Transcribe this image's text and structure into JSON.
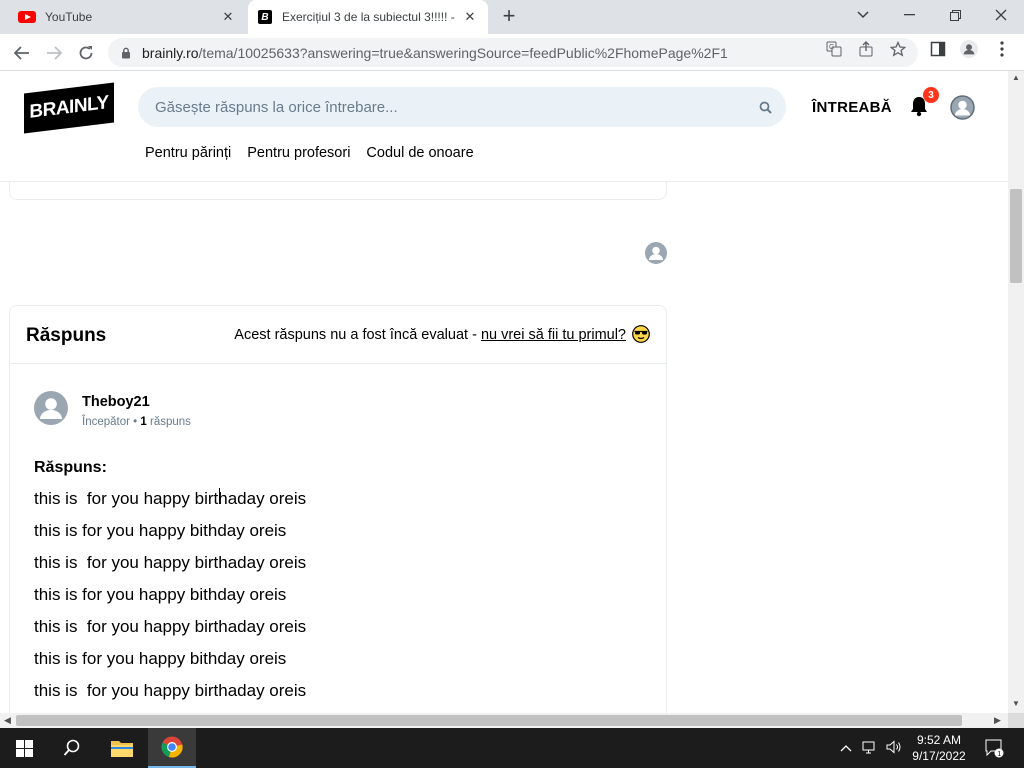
{
  "browser": {
    "tabs": [
      {
        "title": "YouTube",
        "close": "✕"
      },
      {
        "title": "Exercițiul 3 de la subiectul 3!!!!! -",
        "close": "✕"
      }
    ],
    "new_tab": "+",
    "url_host": "brainly.ro",
    "url_path": "/tema/10025633?answering=true&answeringSource=feedPublic%2FhomePage%2F1"
  },
  "header": {
    "logo_text": "BRAINLY",
    "search_placeholder": "Găsește răspuns la orice întrebare...",
    "ask_label": "ÎNTREABĂ",
    "notification_count": "3",
    "nav": [
      "Pentru părinți",
      "Pentru profesori",
      "Codul de onoare"
    ]
  },
  "answer": {
    "heading": "Răspuns",
    "rating_note": "Acest răspuns nu a fost încă evaluat - ",
    "rating_link": "nu vrei să fii tu primul?",
    "author": {
      "name": "Theboy21",
      "rank": "Începător",
      "separator": "•",
      "answers_count": "1",
      "answers_label": "răspuns"
    },
    "answer_label": "Răspuns:",
    "lines": [
      "this is  for you happy birthaday oreis",
      "this is for you happy bithday oreis",
      "this is  for you happy birthaday oreis",
      "this is for you happy bithday oreis",
      "this is  for you happy birthaday oreis",
      "this is for you happy bithday oreis",
      "this is  for you happy birthaday oreis"
    ]
  },
  "taskbar": {
    "time": "9:52 AM",
    "date": "9/17/2022",
    "notifications": "1"
  },
  "colors": {
    "search_bg": "#ebf2f7",
    "badge": "#ff341a",
    "taskbar": "#1c1c1c"
  }
}
